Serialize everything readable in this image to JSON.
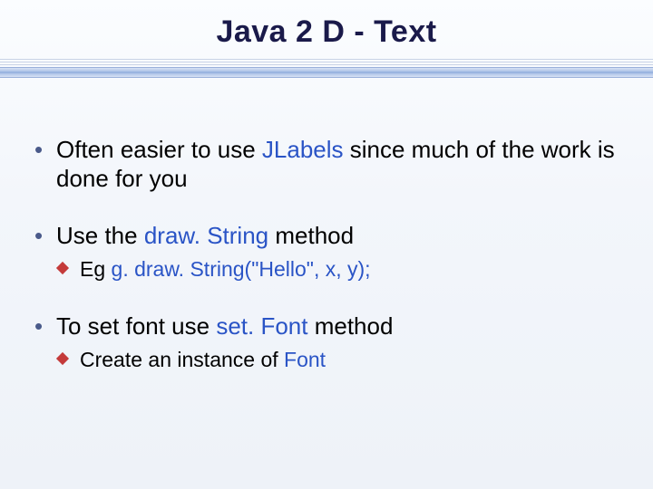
{
  "title": "Java 2 D - Text",
  "bullets": [
    {
      "segments": [
        {
          "t": "Often easier to use "
        },
        {
          "t": "JLabels",
          "kw": true
        },
        {
          "t": " since much of the work is done for you"
        }
      ],
      "sub": []
    },
    {
      "segments": [
        {
          "t": "Use the "
        },
        {
          "t": "draw. String",
          "kw": true
        },
        {
          "t": " method"
        }
      ],
      "sub": [
        {
          "segments": [
            {
              "t": "Eg "
            },
            {
              "t": "g. draw. String(\"Hello\", x, y);",
              "kw": true
            }
          ]
        }
      ]
    },
    {
      "segments": [
        {
          "t": "To set font use "
        },
        {
          "t": "set. Font",
          "kw": true
        },
        {
          "t": " method"
        }
      ],
      "sub": [
        {
          "segments": [
            {
              "t": "Create an instance of "
            },
            {
              "t": "Font",
              "kw": true
            }
          ]
        }
      ]
    }
  ]
}
